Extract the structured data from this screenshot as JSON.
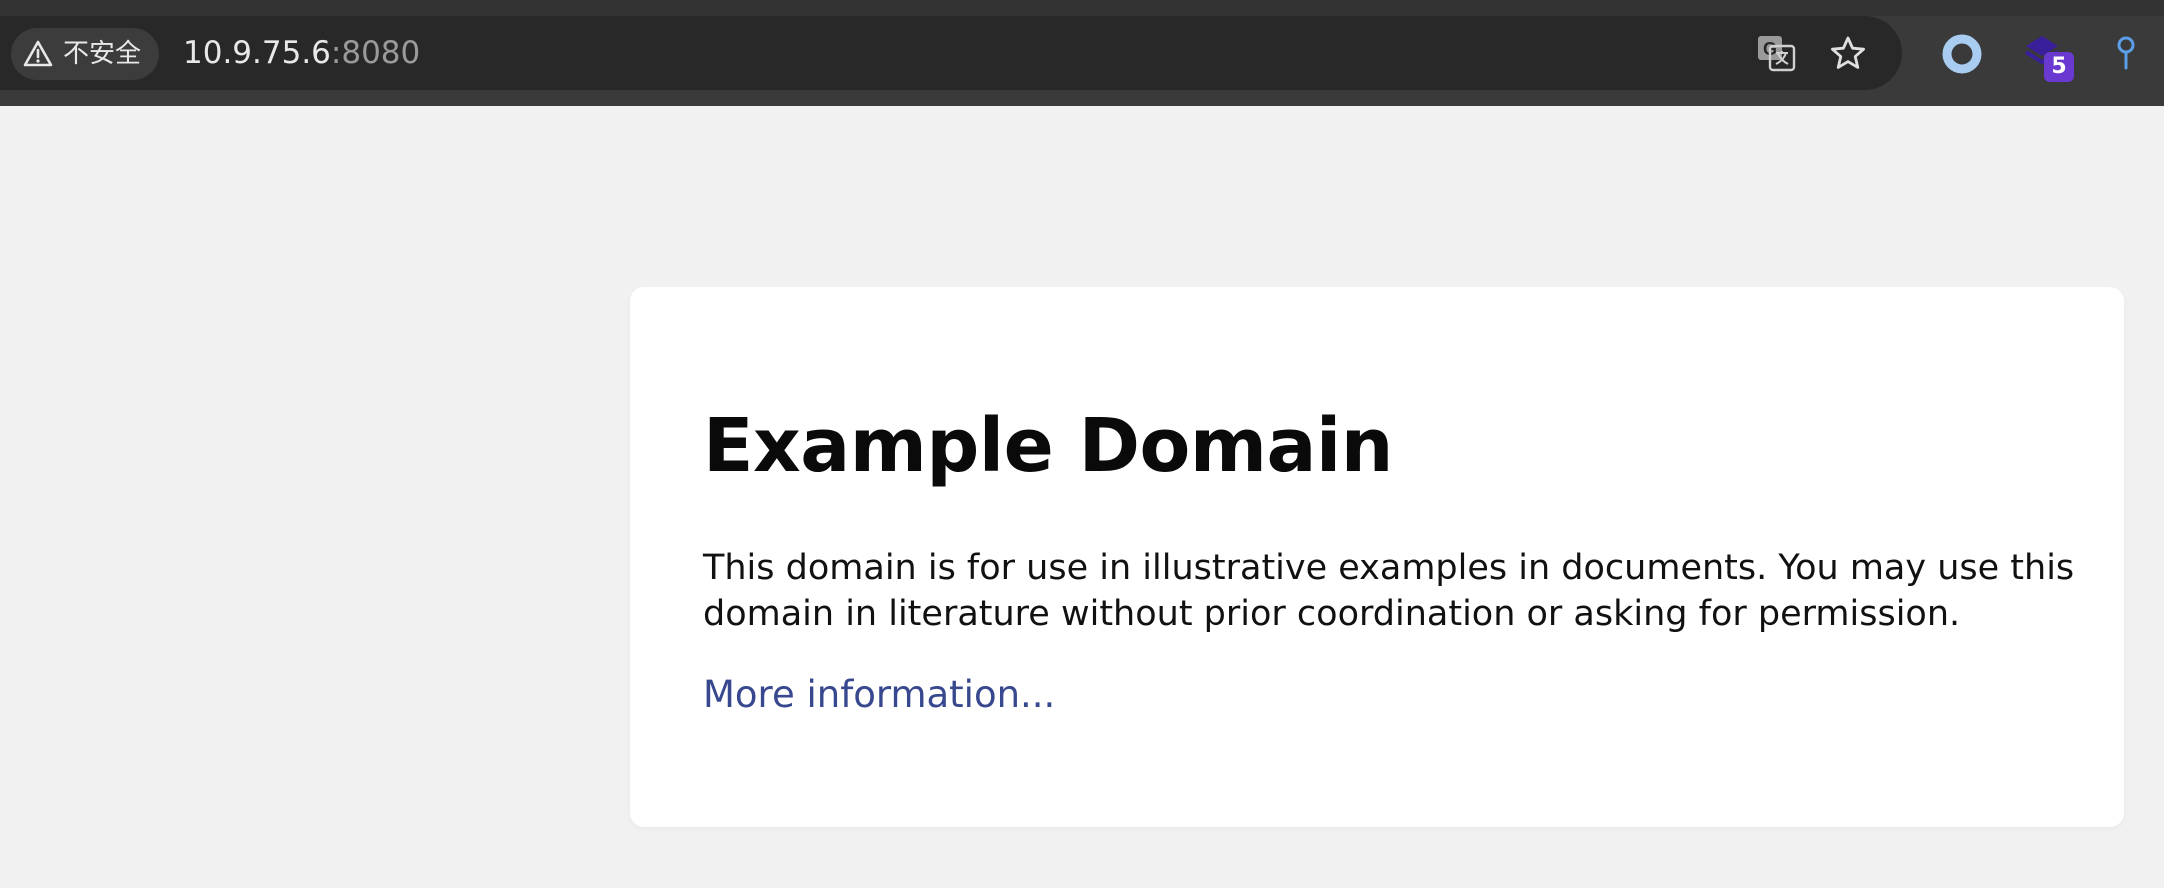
{
  "browser": {
    "security_chip": {
      "icon": "warning-triangle-icon",
      "label": "不安全"
    },
    "address_bar": {
      "host": "10.9.75.6",
      "port": ":8080"
    },
    "omnibox_icons": [
      "translate-icon",
      "bookmark-star-icon"
    ],
    "extensions": [
      {
        "icon": "ring-extension-icon"
      },
      {
        "icon": "stack-extension-icon",
        "badge": "5"
      },
      {
        "icon": "pin-extension-icon"
      }
    ],
    "colors": {
      "chrome_bg": "#3a3a3a",
      "omnibox_bg": "#282828",
      "ring_extension": "#a8cdf0",
      "badge": "#6a3ad0",
      "pin_extension": "#5a9fe8"
    }
  },
  "page": {
    "background": "#f1f1f2",
    "card": {
      "title": "Example Domain",
      "body": "This domain is for use in illustrative examples in documents. You may use this domain in literature without prior coordination or asking for permission.",
      "link_text": "More information...",
      "link_color": "#38488f"
    }
  }
}
